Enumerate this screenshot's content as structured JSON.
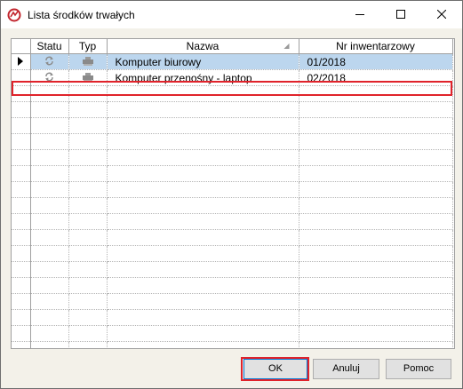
{
  "window": {
    "title": "Lista środków trwałych"
  },
  "grid": {
    "columns": [
      "Statu",
      "Typ",
      "Nazwa",
      "Nr inwentarzowy"
    ],
    "rows": [
      {
        "status_icon": "refresh-icon",
        "type_icon": "computer-icon",
        "name": "Komputer biurowy",
        "inventory": "01/2018",
        "selected": true
      },
      {
        "status_icon": "refresh-icon",
        "type_icon": "computer-icon",
        "name": "Komputer przenośny - laptop",
        "inventory": "02/2018",
        "selected": false
      }
    ],
    "empty_rows": 17
  },
  "buttons": {
    "ok": "OK",
    "cancel": "Anuluj",
    "help": "Pomoc"
  },
  "colors": {
    "selection": "#bcd6ee",
    "highlight_outline": "#e0232b",
    "default_button_border": "#0078d7"
  }
}
